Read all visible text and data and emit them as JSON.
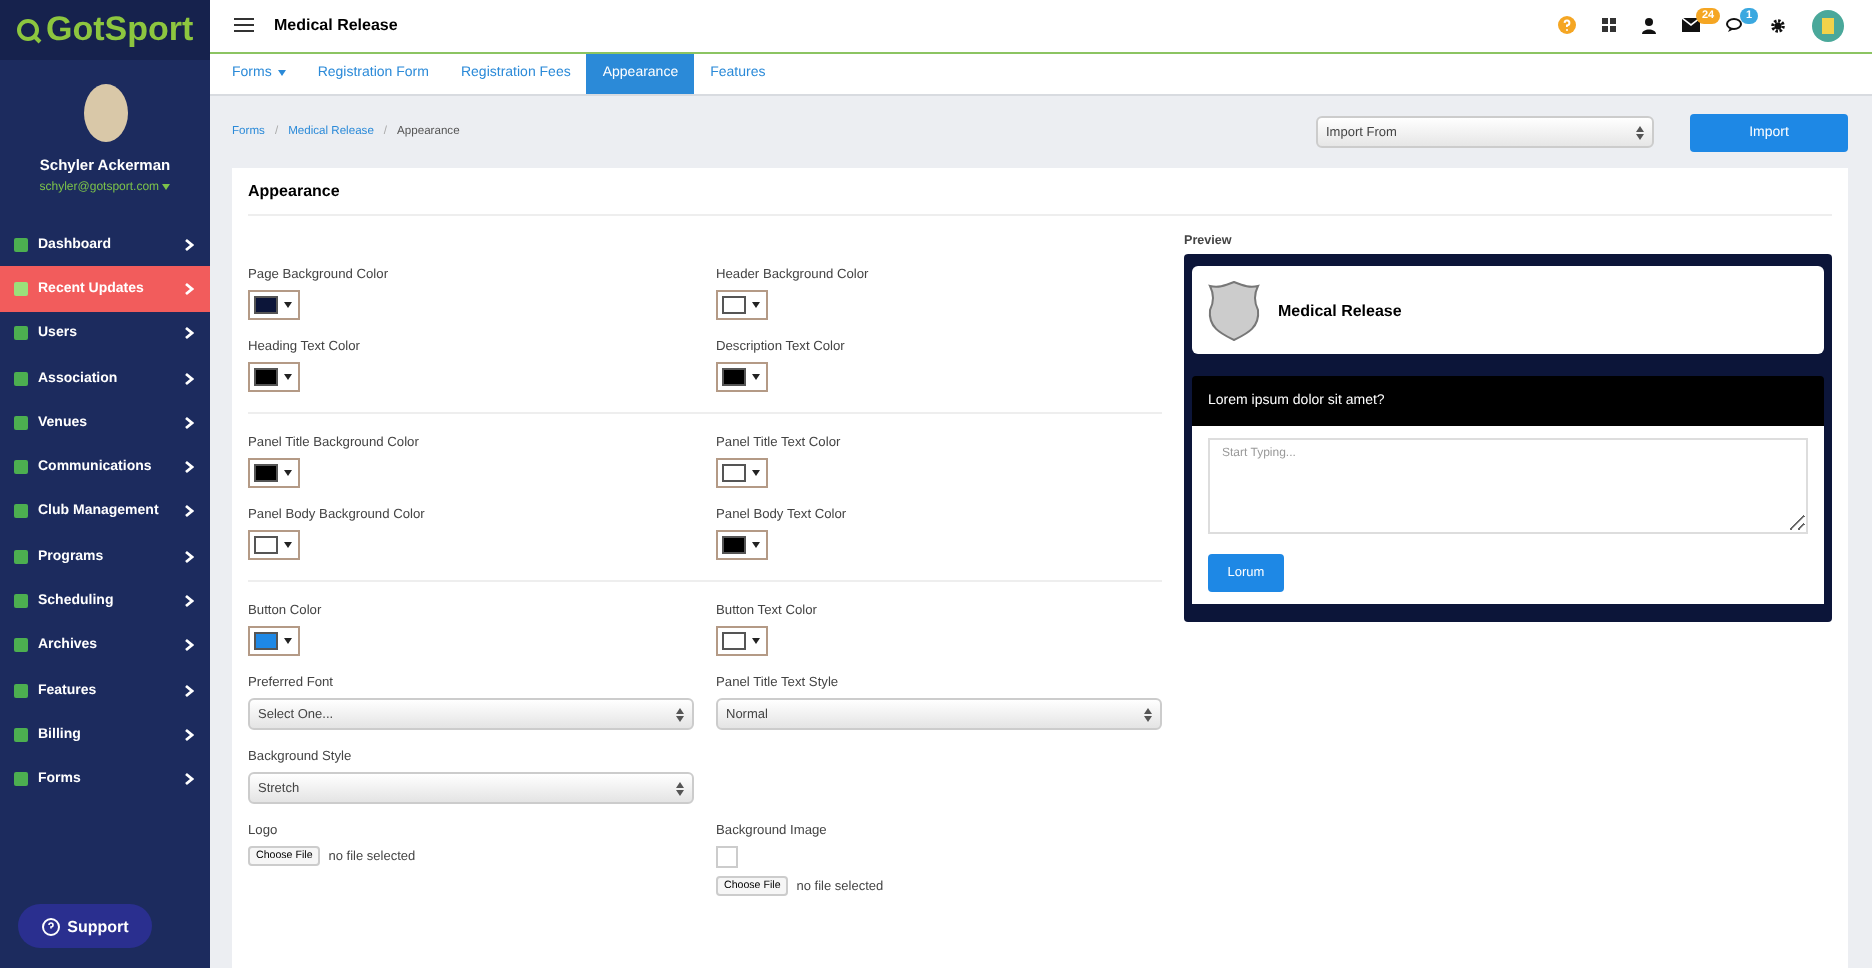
{
  "brand": {
    "name": "GotSport"
  },
  "topbar": {
    "title": "Medical Release",
    "icons": [
      {
        "kind": "help"
      },
      {
        "kind": "grid"
      },
      {
        "kind": "user"
      },
      {
        "kind": "mail",
        "badge": "24",
        "color": "#f5a623"
      },
      {
        "kind": "chat",
        "badge": "1",
        "color": "#3aa8e0"
      },
      {
        "kind": "gear"
      },
      {
        "kind": "avatar"
      }
    ]
  },
  "user": {
    "name": "Schyler Ackerman",
    "email": "schyler@gotsport.com"
  },
  "sidebar": {
    "items": [
      {
        "label": "Dashboard",
        "selected": false
      },
      {
        "label": "Recent Updates",
        "selected": true
      },
      {
        "label": "Users",
        "selected": false
      },
      {
        "label": "Association",
        "selected": false
      },
      {
        "label": "Venues",
        "selected": false
      },
      {
        "label": "Communications",
        "selected": false
      },
      {
        "label": "Club Management",
        "selected": false
      },
      {
        "label": "Programs",
        "selected": false
      },
      {
        "label": "Scheduling",
        "selected": false
      },
      {
        "label": "Archives",
        "selected": false
      },
      {
        "label": "Features",
        "selected": false
      },
      {
        "label": "Billing",
        "selected": false
      },
      {
        "label": "Forms",
        "selected": false
      }
    ],
    "support": "Support"
  },
  "tabs": [
    {
      "label": "Forms",
      "dropdown": true,
      "selected": false
    },
    {
      "label": "Registration Form",
      "dropdown": false,
      "selected": false
    },
    {
      "label": "Registration Fees",
      "dropdown": false,
      "selected": false
    },
    {
      "label": "Appearance",
      "dropdown": false,
      "selected": true
    },
    {
      "label": "Features",
      "dropdown": false,
      "selected": false
    }
  ],
  "breadcrumb": {
    "items": [
      "Forms",
      "Medical Release",
      "Appearance"
    ],
    "separator": "/"
  },
  "import": {
    "placeholder": "Import From",
    "button": "Import"
  },
  "card": {
    "title": "Appearance",
    "sections": [
      [
        [
          {
            "kind": "color",
            "label": "Page Background Color",
            "color": "#0c1539"
          },
          {
            "kind": "color",
            "label": "Header Background Color",
            "color": "#ffffff"
          }
        ],
        [
          {
            "kind": "color",
            "label": "Heading Text Color",
            "color": "#000000"
          },
          {
            "kind": "color",
            "label": "Description Text Color",
            "color": "#000000"
          }
        ]
      ],
      [
        [
          {
            "kind": "color",
            "label": "Panel Title Background Color",
            "color": "#000000"
          },
          {
            "kind": "color",
            "label": "Panel Title Text Color",
            "color": "#ffffff"
          }
        ],
        [
          {
            "kind": "color",
            "label": "Panel Body Background Color",
            "color": "#ffffff"
          },
          {
            "kind": "color",
            "label": "Panel Body Text Color",
            "color": "#000000"
          }
        ]
      ],
      [
        [
          {
            "kind": "color",
            "label": "Button Color",
            "color": "#1e88e5"
          },
          {
            "kind": "color",
            "label": "Button Text Color",
            "color": "#ffffff"
          }
        ],
        [
          {
            "kind": "select",
            "label": "Preferred Font",
            "value": "Select One..."
          },
          {
            "kind": "select",
            "label": "Panel Title Text Style",
            "value": "Normal"
          }
        ],
        [
          {
            "kind": "select",
            "label": "Background Style",
            "value": "Stretch"
          }
        ],
        [
          {
            "kind": "file",
            "label": "Logo",
            "button": "Choose File",
            "status": "no file selected"
          },
          {
            "kind": "file",
            "label": "Background Image",
            "button": "Choose File",
            "status": "no file selected",
            "thumbnail": true
          }
        ]
      ]
    ]
  },
  "preview": {
    "label": "Preview",
    "title": "Medical Release",
    "question": "Lorem ipsum dolor sit amet?",
    "placeholder": "Start Typing...",
    "button": "Lorum"
  }
}
